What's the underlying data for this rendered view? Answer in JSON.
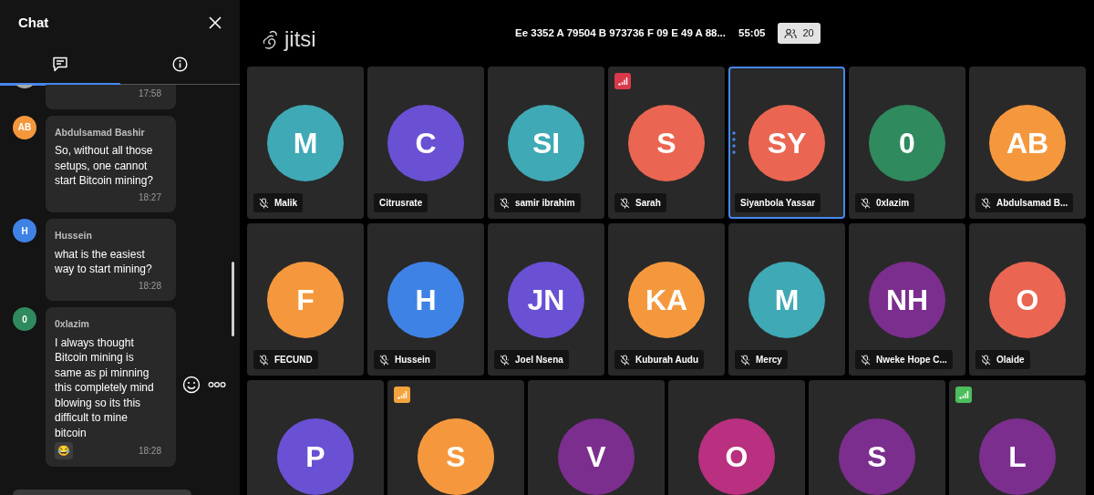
{
  "chat": {
    "title": "Chat",
    "tabs": [
      {
        "kind": "chat",
        "selected": true
      },
      {
        "kind": "info",
        "selected": false
      }
    ],
    "messages": [
      {
        "avatar": {
          "color": "#a8a8a8"
        },
        "time": "17:58"
      },
      {
        "avatar": {
          "initials": "AB",
          "color": "#f5983d"
        },
        "sender": "Abdulsamad Bashir",
        "text": "So, without all those setups, one cannot start Bitcoin mining?",
        "time": "18:27"
      },
      {
        "avatar": {
          "initials": "H",
          "color": "#3f82e6"
        },
        "sender": "Hussein",
        "text": "what is the easiest way to start mining?",
        "time": "18:28"
      },
      {
        "avatar": {
          "initials": "0",
          "color": "#2f8a5e"
        },
        "sender": "0xlazim",
        "text": "I always thought Bitcoin mining is same as pi minning this completely mind blowing so its this difficult to mine bitcoin",
        "reaction": "😂",
        "time": "18:28",
        "hovered": true
      }
    ]
  },
  "header": {
    "logo": "jitsi",
    "meeting_title": "Ee 3352 A 79504 B 973736 F 09 E 49 A 88...",
    "timer": "55:05",
    "participant_count": "20"
  },
  "tile_rows": [
    [
      {
        "initials": "M",
        "color": "#3fa9b5",
        "name": "Malik",
        "muted": true,
        "selected": false
      },
      {
        "initials": "C",
        "color": "#6a50d3",
        "name": "Citrusrate",
        "muted": false,
        "selected": false
      },
      {
        "initials": "SI",
        "color": "#3fa9b5",
        "name": "samir ibrahim",
        "muted": true,
        "selected": false
      },
      {
        "initials": "S",
        "color": "#ea6652",
        "name": "Sarah",
        "muted": true,
        "selected": false,
        "connection": {
          "color": "#d9394a"
        }
      },
      {
        "initials": "SY",
        "color": "#ea6652",
        "name": "Siyanbola Yassar",
        "muted": false,
        "selected": true
      },
      {
        "initials": "0",
        "color": "#2f8a5e",
        "name": "0xlazim",
        "muted": true,
        "selected": false
      },
      {
        "initials": "AB",
        "color": "#f5983d",
        "name": "Abdulsamad B...",
        "muted": true,
        "selected": false
      }
    ],
    [
      {
        "initials": "F",
        "color": "#f5983d",
        "name": "FECUND",
        "muted": true,
        "selected": false
      },
      {
        "initials": "H",
        "color": "#3f82e6",
        "name": "Hussein",
        "muted": true,
        "selected": false
      },
      {
        "initials": "JN",
        "color": "#6a50d3",
        "name": "Joel Nsena",
        "muted": true,
        "selected": false
      },
      {
        "initials": "KA",
        "color": "#f5983d",
        "name": "Kuburah Audu",
        "muted": true,
        "selected": false
      },
      {
        "initials": "M",
        "color": "#3fa9b5",
        "name": "Mercy",
        "muted": true,
        "selected": false
      },
      {
        "initials": "NH",
        "color": "#7b2e8e",
        "name": "Nweke Hope C...",
        "muted": true,
        "selected": false
      },
      {
        "initials": "O",
        "color": "#ea6652",
        "name": "Olaide",
        "muted": true,
        "selected": false
      }
    ],
    [
      {
        "initials": "P",
        "color": "#6a50d3",
        "selected": false
      },
      {
        "initials": "S",
        "color": "#f5983d",
        "selected": false,
        "connection": {
          "color": "#f5a33d"
        }
      },
      {
        "initials": "V",
        "color": "#7b2e8e",
        "selected": false
      },
      {
        "initials": "O",
        "color": "#b8307f",
        "selected": false
      },
      {
        "initials": "S",
        "color": "#7b2e8e",
        "selected": false
      },
      {
        "initials": "L",
        "color": "#7b2e8e",
        "selected": false,
        "connection": {
          "color": "#4cbe5c"
        }
      }
    ]
  ]
}
